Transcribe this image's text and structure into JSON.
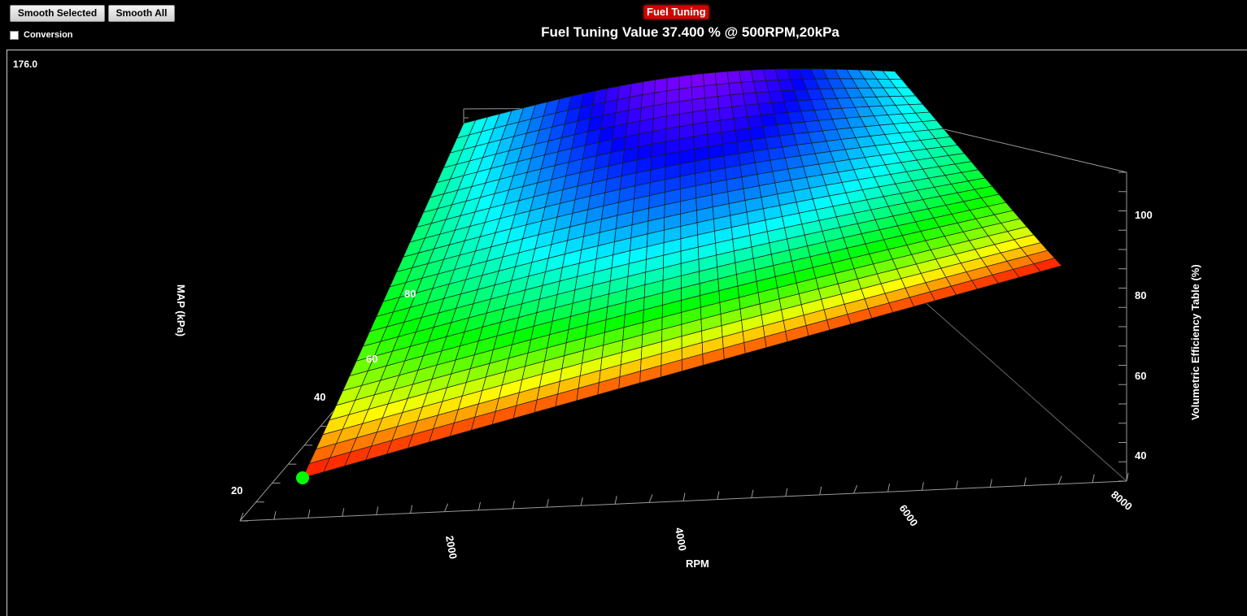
{
  "toolbar": {
    "smooth_selected_label": "Smooth Selected",
    "smooth_all_label": "Smooth All",
    "conversion_label": "Conversion",
    "conversion_checked": false
  },
  "header": {
    "badge": "Fuel Tuning",
    "value_title": "Fuel Tuning Value 37.400 % @ 500RPM,20kPa"
  },
  "plot": {
    "corner_value": "176.0"
  },
  "chart_data": {
    "type": "surface3d",
    "xlabel": "RPM",
    "ylabel": "MAP (kPa)",
    "zlabel": "Volumetric Efficiency Table (%)",
    "xticks": [
      "2000",
      "4000",
      "6000",
      "8000"
    ],
    "yticks": [
      "20",
      "40",
      "60",
      "80"
    ],
    "zticks": [
      "40",
      "60",
      "80",
      "100"
    ],
    "xlim": [
      500,
      8000
    ],
    "ylim": [
      20,
      100
    ],
    "zlim": [
      35,
      110
    ],
    "selected_point": {
      "rpm": 500,
      "kpa": 20,
      "value": 37.4
    },
    "colors": {
      "low": "#ff0000",
      "high": "#ff00ff",
      "marker": "#00ff00"
    }
  }
}
